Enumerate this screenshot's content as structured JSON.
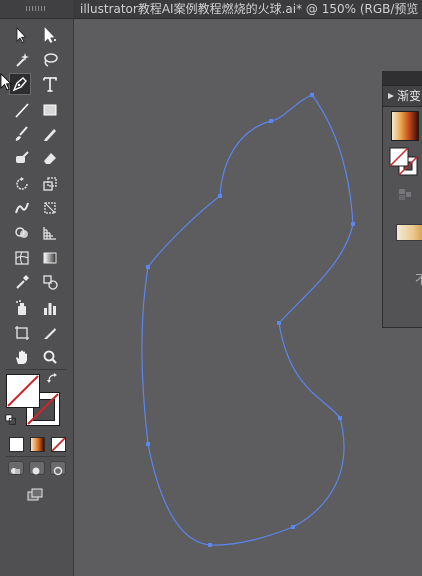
{
  "window": {
    "tab_title": "illustrator教程AI案例教程燃烧的火球.ai* @ 150% (RGB/预览"
  },
  "tools": {
    "items": [
      {
        "name": "selection-tool",
        "icon": "selection-arrow-icon"
      },
      {
        "name": "direct-selection-tool",
        "icon": "direct-selection-arrow-icon"
      },
      {
        "name": "magic-wand-tool",
        "icon": "magic-wand-icon"
      },
      {
        "name": "lasso-tool",
        "icon": "lasso-icon"
      },
      {
        "name": "pen-tool",
        "icon": "pen-icon",
        "active": true
      },
      {
        "name": "type-tool",
        "icon": "type-t-icon"
      },
      {
        "name": "line-segment-tool",
        "icon": "line-icon"
      },
      {
        "name": "rectangle-tool",
        "icon": "rectangle-icon"
      },
      {
        "name": "paintbrush-tool",
        "icon": "paintbrush-icon"
      },
      {
        "name": "pencil-tool",
        "icon": "pencil-icon"
      },
      {
        "name": "blob-brush-tool",
        "icon": "blob-brush-icon"
      },
      {
        "name": "eraser-tool",
        "icon": "eraser-icon"
      },
      {
        "name": "rotate-tool",
        "icon": "rotate-icon"
      },
      {
        "name": "scale-tool",
        "icon": "scale-icon"
      },
      {
        "name": "width-tool",
        "icon": "width-icon"
      },
      {
        "name": "free-transform-tool",
        "icon": "free-transform-icon"
      },
      {
        "name": "shape-builder-tool",
        "icon": "shape-builder-icon"
      },
      {
        "name": "perspective-grid-tool",
        "icon": "perspective-grid-icon"
      },
      {
        "name": "mesh-tool",
        "icon": "mesh-icon"
      },
      {
        "name": "gradient-tool",
        "icon": "gradient-icon"
      },
      {
        "name": "eyedropper-tool",
        "icon": "eyedropper-icon"
      },
      {
        "name": "blend-tool",
        "icon": "blend-icon"
      },
      {
        "name": "symbol-sprayer-tool",
        "icon": "symbol-sprayer-icon"
      },
      {
        "name": "column-graph-tool",
        "icon": "column-graph-icon"
      },
      {
        "name": "artboard-tool",
        "icon": "artboard-icon"
      },
      {
        "name": "slice-tool",
        "icon": "slice-icon"
      },
      {
        "name": "hand-tool",
        "icon": "hand-icon"
      },
      {
        "name": "zoom-tool",
        "icon": "zoom-icon"
      }
    ],
    "fill": {
      "icon": "fill-none-swatch-icon",
      "color": "#ffffff"
    },
    "stroke": {
      "icon": "stroke-swatch-icon",
      "color": "#4e4d50"
    },
    "modes": [
      {
        "name": "color-mode",
        "icon": "color-icon",
        "color": "#ffffff"
      },
      {
        "name": "gradient-mode",
        "icon": "gradient-icon",
        "color": "#e07020"
      },
      {
        "name": "none-mode",
        "icon": "none-icon",
        "color": "#cc2222"
      }
    ],
    "drawing_modes": [
      "draw-normal-icon",
      "draw-behind-icon",
      "draw-inside-icon"
    ],
    "screen_mode_icon": "screen-mode-icon"
  },
  "gradient_panel": {
    "tab_label": "渐变",
    "collapse_icon": "panel-collapse-icon",
    "partial_text": "不",
    "colors": {
      "dark": "#3e0f09",
      "mid": "#c24a1e",
      "light": "#f4ead2"
    }
  },
  "canvas": {
    "background": "#5d5c5f",
    "path_color": "#5b86f0"
  }
}
